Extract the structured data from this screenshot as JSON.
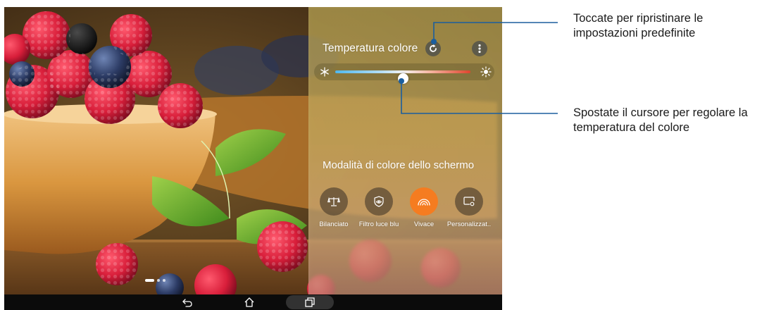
{
  "panel": {
    "color_temperature_title": "Temperatura colore",
    "temperature_slider_position": 0.5,
    "screen_color_mode_title": "Modalità di colore dello schermo",
    "modes": [
      {
        "label": "Bilanciato",
        "icon": "balance-scale-icon",
        "active": false
      },
      {
        "label": "Filtro luce blu",
        "icon": "eye-shield-icon",
        "active": false
      },
      {
        "label": "Vivace",
        "icon": "rainbow-icon",
        "active": true
      },
      {
        "label": "Personalizzat..",
        "icon": "custom-settings-icon",
        "active": false
      }
    ],
    "accent_color": "#f57c20"
  },
  "home_screen": {
    "page_indicator": {
      "pages": 3,
      "current": 1
    }
  },
  "navigation_bar": {
    "buttons": [
      "back-icon",
      "home-icon",
      "recent-apps-icon"
    ]
  },
  "callouts": {
    "reset_text": "Toccate per ripristinare le impostazioni predefinite",
    "reset_line1": "Toccate per ripristinare le",
    "reset_line2": "impostazioni predefinite",
    "slider_line1": "Spostate il cursore per regolare la",
    "slider_line2": "temperatura del colore",
    "line_color": "#1b5e9e"
  }
}
